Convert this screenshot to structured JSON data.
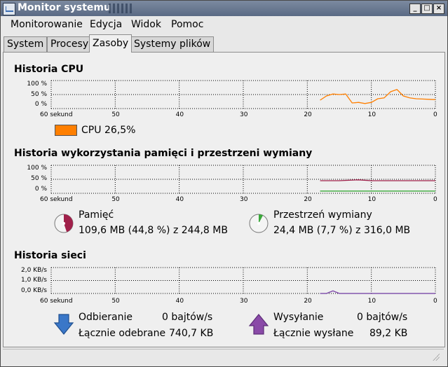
{
  "window": {
    "title": "Monitor systemu",
    "btn_min": "_",
    "btn_max": "□",
    "btn_close": "×"
  },
  "menu": {
    "items": [
      "Monitorowanie",
      "Edycja",
      "Widok",
      "Pomoc"
    ]
  },
  "tabs": [
    {
      "label": "System"
    },
    {
      "label": "Procesy"
    },
    {
      "label": "Zasoby"
    },
    {
      "label": "Systemy plików"
    }
  ],
  "active_tab": "Zasoby",
  "cpu": {
    "title": "Historia CPU",
    "y_ticks": [
      "100 %",
      "50 %",
      "0 %"
    ],
    "x_ticks": [
      "60 sekund",
      "50",
      "40",
      "30",
      "20",
      "10",
      "0"
    ],
    "legend_label": "CPU",
    "legend_value": "26,5%",
    "color": "#ff7f00"
  },
  "memory": {
    "title": "Historia wykorzystania pamięci i przestrzeni wymiany",
    "y_ticks": [
      "100 %",
      "50 %",
      "0 %"
    ],
    "x_ticks": [
      "60 sekund",
      "50",
      "40",
      "30",
      "20",
      "10",
      "0"
    ],
    "mem_label": "Pamięć",
    "mem_value": "109,6 MB (44,8 %) z 244,8 MB",
    "mem_color": "#a0204a",
    "swap_label": "Przestrzeń wymiany",
    "swap_value": "24,4 MB (7,7 %) z 316,0 MB",
    "swap_color": "#3aa83a"
  },
  "network": {
    "title": "Historia sieci",
    "y_ticks": [
      "2,0 KB/s",
      "1,0 KB/s",
      "0,0 KB/s"
    ],
    "x_ticks": [
      "60 sekund",
      "50",
      "40",
      "30",
      "20",
      "10",
      "0"
    ],
    "rx_label": "Odbieranie",
    "rx_value": "0 bajtów/s",
    "rx_total_label": "Łącznie odebrane",
    "rx_total_value": "740,7 KB",
    "rx_color": "#3a77c8",
    "tx_label": "Wysyłanie",
    "tx_value": "0 bajtów/s",
    "tx_total_label": "Łącznie wysłane",
    "tx_total_value": "89,2 KB",
    "tx_color": "#8a4aa8"
  },
  "chart_data": [
    {
      "type": "line",
      "title": "Historia CPU",
      "xlabel": "",
      "ylabel": "",
      "x_unit": "seconds ago",
      "xlim": [
        60,
        0
      ],
      "ylim": [
        0,
        100
      ],
      "series": [
        {
          "name": "CPU",
          "color": "#ff7f00",
          "x": [
            18,
            17,
            16,
            15,
            14,
            13,
            12,
            11,
            10,
            9,
            8,
            7,
            6,
            5,
            4,
            3,
            2,
            1,
            0
          ],
          "values": [
            30,
            45,
            52,
            50,
            52,
            20,
            22,
            18,
            22,
            35,
            38,
            60,
            68,
            45,
            38,
            35,
            34,
            33,
            32
          ]
        }
      ]
    },
    {
      "type": "line",
      "title": "Historia wykorzystania pamięci i przestrzeni wymiany",
      "xlabel": "",
      "ylabel": "",
      "x_unit": "seconds ago",
      "xlim": [
        60,
        0
      ],
      "ylim": [
        0,
        100
      ],
      "series": [
        {
          "name": "Pamięć",
          "color": "#a0204a",
          "x": [
            18,
            15,
            12,
            10,
            5,
            0
          ],
          "values": [
            45,
            45,
            48,
            45,
            45,
            45
          ]
        },
        {
          "name": "Przestrzeń wymiany",
          "color": "#3aa83a",
          "x": [
            18,
            0
          ],
          "values": [
            8,
            8
          ]
        }
      ]
    },
    {
      "type": "line",
      "title": "Historia sieci",
      "xlabel": "",
      "ylabel": "",
      "x_unit": "seconds ago",
      "y_unit": "KB/s",
      "xlim": [
        60,
        0
      ],
      "ylim": [
        0,
        2
      ],
      "series": [
        {
          "name": "Odbieranie",
          "color": "#3a77c8",
          "x": [
            18,
            17,
            16,
            15,
            14,
            0
          ],
          "values": [
            0,
            0,
            0.2,
            0,
            0,
            0
          ]
        },
        {
          "name": "Wysyłanie",
          "color": "#8a4aa8",
          "x": [
            18,
            17,
            16,
            15,
            14,
            0
          ],
          "values": [
            0,
            0,
            0.2,
            0,
            0,
            0
          ]
        }
      ]
    }
  ]
}
